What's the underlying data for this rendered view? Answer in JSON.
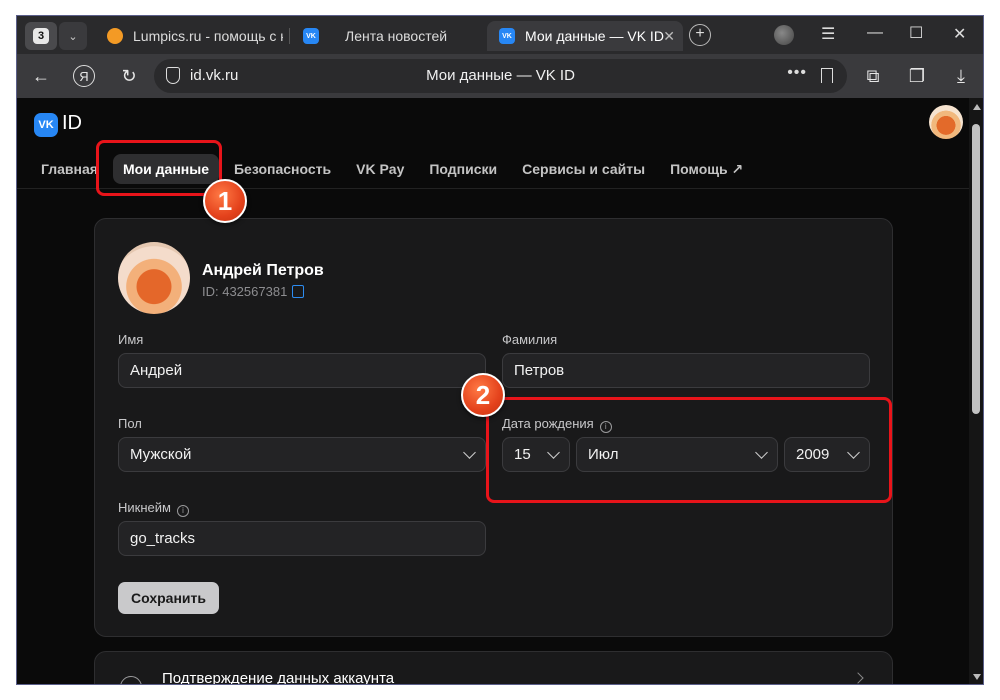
{
  "browser": {
    "tab_count": "3",
    "tabs": [
      {
        "label": "Lumpics.ru - помощь с ко",
        "favicon": "lumpics-favicon"
      },
      {
        "label": "Лента новостей",
        "favicon": "vk-favicon"
      },
      {
        "label": "Мои данные — VK ID",
        "favicon": "vk-favicon",
        "active": true
      }
    ],
    "url_domain": "id.vk.ru",
    "page_title": "Мои данные — VK ID",
    "more_glyph": "•••"
  },
  "header": {
    "logo_text": "VK",
    "id_text": "ID"
  },
  "nav": {
    "items": [
      "Главная",
      "Мои данные",
      "Безопасность",
      "VK Pay",
      "Подписки",
      "Сервисы и сайты",
      "Помощь ↗"
    ],
    "active_index": 1
  },
  "profile": {
    "name": "Андрей Петров",
    "id_label": "ID: 432567381"
  },
  "form": {
    "first_name_label": "Имя",
    "first_name_value": "Андрей",
    "last_name_label": "Фамилия",
    "last_name_value": "Петров",
    "gender_label": "Пол",
    "gender_value": "Мужской",
    "birthdate_label": "Дата рождения",
    "birth_day": "15",
    "birth_month": "Июл",
    "birth_year": "2009",
    "nickname_label": "Никнейм",
    "nickname_value": "go_tracks",
    "save_label": "Сохранить",
    "info_glyph": "i"
  },
  "section2": {
    "title": "Подтверждение данных аккаунта"
  },
  "annotations": {
    "badge1": "1",
    "badge2": "2"
  },
  "colors": {
    "accent_blue": "#2787f5",
    "annotation_red": "#e8141a",
    "page_bg": "#0a0a0a",
    "card_bg": "#19191a"
  }
}
